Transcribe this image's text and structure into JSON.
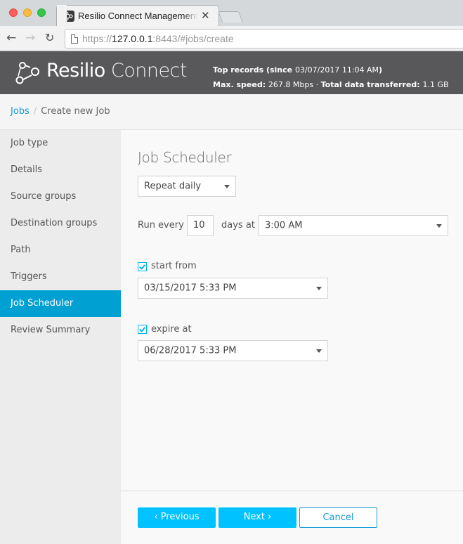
{
  "browser": {
    "tab_title": "Resilio Connect Management Console",
    "tab_close_glyph": "✕",
    "nav_back_glyph": "←",
    "nav_forward_glyph": "→",
    "nav_reload_glyph": "↻",
    "url_scheme": "https://",
    "url_host": "127.0.0.1",
    "url_rest": ":8443/#jobs/create"
  },
  "header": {
    "brand_bold": "Resilio",
    "brand_light": "Connect",
    "stats_line1_label": "Top records (since ",
    "stats_line1_value": "03/07/2017 11:04 AM",
    "stats_line1_end": ")",
    "max_speed_label": "Max. speed: ",
    "max_speed_value": "267.8 Mbps",
    "separator": " · ",
    "total_label": "Total data transferred: ",
    "total_value": "1.1 GB"
  },
  "breadcrumb": {
    "parent": "Jobs",
    "separator": "/",
    "current": "Create new Job"
  },
  "sidebar": {
    "items": [
      {
        "label": "Job type",
        "active": false
      },
      {
        "label": "Details",
        "active": false
      },
      {
        "label": "Source groups",
        "active": false
      },
      {
        "label": "Destination groups",
        "active": false
      },
      {
        "label": "Path",
        "active": false
      },
      {
        "label": "Triggers",
        "active": false
      },
      {
        "label": "Job Scheduler",
        "active": true
      },
      {
        "label": "Review Summary",
        "active": false
      }
    ]
  },
  "main": {
    "title": "Job Scheduler",
    "repeat_select": "Repeat daily",
    "run_every_label": "Run every",
    "run_every_value": "10",
    "days_at_label": "days at",
    "time_select": "3:00 AM",
    "start_from": {
      "label": "start from",
      "checked": true,
      "value": "03/15/2017 5:33 PM"
    },
    "expire_at": {
      "label": "expire at",
      "checked": true,
      "value": "06/28/2017 5:33 PM"
    }
  },
  "footer": {
    "previous_label": "‹ Previous",
    "next_label": "Next ›",
    "cancel_label": "Cancel"
  },
  "colors": {
    "accent": "#00c2ff",
    "active_nav": "#00a0d2",
    "link": "#1a9ad6",
    "header_bg": "#58585a"
  }
}
